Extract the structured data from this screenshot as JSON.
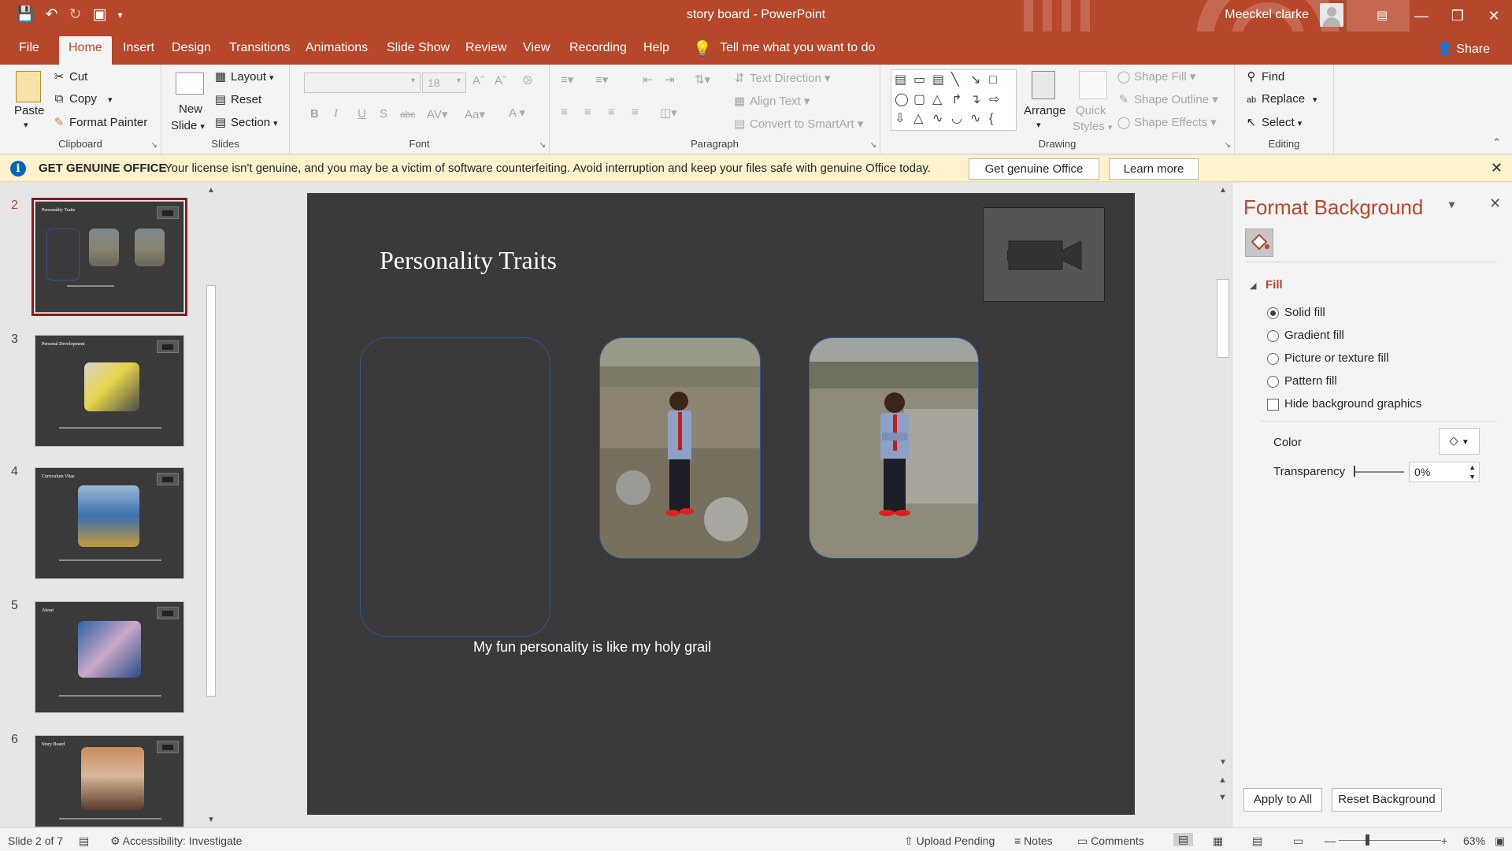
{
  "window": {
    "title": "story board  -  PowerPoint",
    "user": "Meeckel clarke",
    "share": "Share"
  },
  "tabs": [
    "File",
    "Home",
    "Insert",
    "Design",
    "Transitions",
    "Animations",
    "Slide Show",
    "Review",
    "View",
    "Recording",
    "Help"
  ],
  "tell_me": "Tell me what you want to do",
  "ribbon": {
    "clipboard": {
      "label": "Clipboard",
      "paste": "Paste",
      "cut": "Cut",
      "copy": "Copy",
      "format_painter": "Format Painter"
    },
    "slides": {
      "label": "Slides",
      "new_slide_1": "New",
      "new_slide_2": "Slide",
      "layout": "Layout",
      "reset": "Reset",
      "section": "Section"
    },
    "font": {
      "label": "Font",
      "font_name": "",
      "font_size": "18"
    },
    "paragraph": {
      "label": "Paragraph",
      "text_direction": "Text Direction",
      "align_text": "Align Text",
      "convert_smartart": "Convert to SmartArt"
    },
    "drawing": {
      "label": "Drawing",
      "arrange": "Arrange",
      "quick_styles_1": "Quick",
      "quick_styles_2": "Styles",
      "shape_fill": "Shape Fill",
      "shape_outline": "Shape Outline",
      "shape_effects": "Shape Effects"
    },
    "editing": {
      "label": "Editing",
      "find": "Find",
      "replace": "Replace",
      "select": "Select"
    }
  },
  "genuine_bar": {
    "title": "GET GENUINE OFFICE",
    "message": "Your license isn't genuine, and you may be a victim of software counterfeiting. Avoid interruption and keep your files safe with genuine Office today.",
    "get_button": "Get genuine Office",
    "learn_button": "Learn more"
  },
  "thumbnails": [
    {
      "num": "2",
      "title": "Personality Traits"
    },
    {
      "num": "3",
      "title": "Personal Development"
    },
    {
      "num": "4",
      "title": "Curriculum Vitae"
    },
    {
      "num": "5",
      "title": "About"
    },
    {
      "num": "6",
      "title": "Story Board"
    }
  ],
  "slide": {
    "title": "Personality Traits",
    "caption": "My  fun personality is like my holy grail"
  },
  "format_pane": {
    "title": "Format Background",
    "section": "Fill",
    "options": [
      "Solid fill",
      "Gradient fill",
      "Picture or texture fill",
      "Pattern fill"
    ],
    "selected_option": "Solid fill",
    "hide_bg": "Hide background graphics",
    "color_label": "Color",
    "transparency_label": "Transparency",
    "transparency_value": "0%",
    "apply_all": "Apply to All",
    "reset_bg": "Reset Background"
  },
  "status": {
    "slide_of": "Slide 2 of 7",
    "accessibility": "Accessibility: Investigate",
    "upload": "Upload Pending",
    "notes": "Notes",
    "comments": "Comments",
    "zoom": "63%"
  },
  "colors": {
    "accent": "#b7472a",
    "slide_bg": "#3a3a3a",
    "genuine_bar": "#fdf2cc"
  }
}
